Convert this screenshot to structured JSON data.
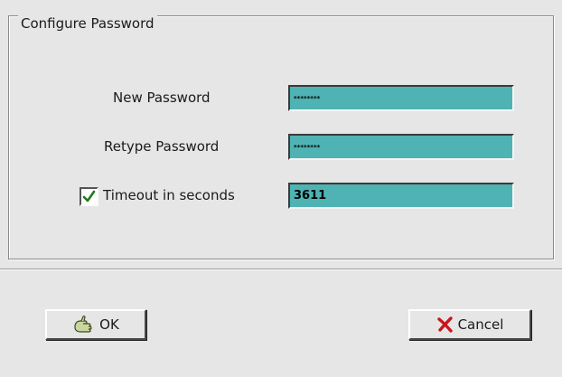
{
  "group": {
    "title": "Configure Password"
  },
  "fields": {
    "new_password": {
      "label": "New Password",
      "value": "********"
    },
    "retype_password": {
      "label": "Retype Password",
      "value": "********"
    },
    "timeout": {
      "label": "Timeout in seconds",
      "value": "3611",
      "enabled": true
    }
  },
  "buttons": {
    "ok": {
      "label": "OK",
      "icon": "ok-hand-icon"
    },
    "cancel": {
      "label": "Cancel",
      "icon": "red-x-icon"
    }
  },
  "colors": {
    "field_bg": "#4fb3b3",
    "window_bg": "#e6e6e6",
    "check": "#1f7a1f",
    "cancel_x": "#c8161d"
  }
}
